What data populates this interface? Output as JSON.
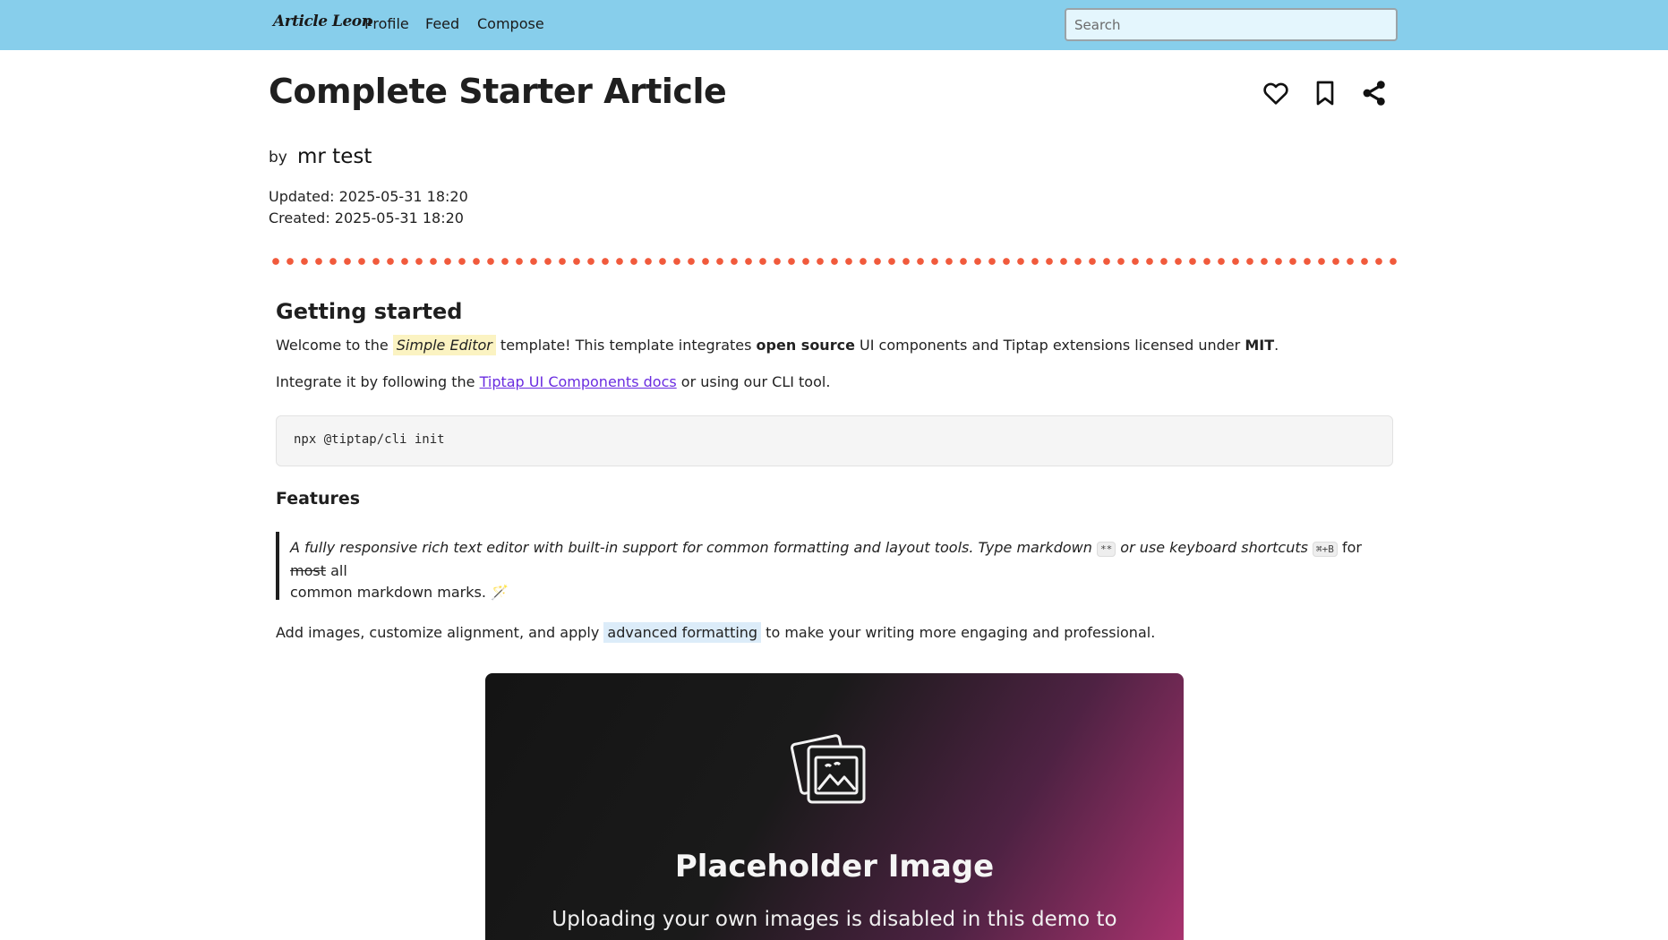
{
  "nav": {
    "brand": "Article Leon",
    "links": [
      "Profile",
      "Feed",
      "Compose"
    ],
    "search_placeholder": "Search"
  },
  "article": {
    "title": "Complete Starter Article",
    "by_label": "by",
    "author": "mr test",
    "updated": "Updated: 2025-05-31 18:20",
    "created": "Created: 2025-05-31 18:20",
    "actions": {
      "like_icon": "heart-icon",
      "bookmark_icon": "bookmark-icon",
      "share_icon": "share-icon"
    }
  },
  "content": {
    "h_getting_started": "Getting started",
    "p1": {
      "a": "Welcome to the ",
      "highlight": "Simple Editor",
      "b": " template! This template integrates ",
      "bold1": "open source",
      "c": " UI components and Tiptap extensions licensed under ",
      "bold2": "MIT",
      "d": "."
    },
    "p2": {
      "a": "Integrate it by following the ",
      "link": "Tiptap UI Components docs",
      "b": " or using our CLI tool."
    },
    "code": "npx @tiptap/cli init",
    "h_features": "Features",
    "quote": {
      "a": "A fully responsive rich text editor with built-in support for common formatting and layout tools. Type markdown ",
      "kbd1": "**",
      "b": " or use keyboard shortcuts ",
      "kbd2": "⌘+B",
      "c": " for ",
      "strike": "most",
      "d": " all",
      "e": "common markdown marks. ",
      "emoji": "🪄"
    },
    "p3": {
      "a": "Add images, customize alignment, and apply ",
      "highlight": "advanced formatting",
      "b": " to make your writing more engaging and professional."
    },
    "image": {
      "icon": "image-placeholder-icon",
      "title": "Placeholder Image",
      "subtitle": "Uploading your own images is disabled in this demo to"
    }
  },
  "colors": {
    "nav_bg": "#87ceeb",
    "divider_dots": "#f15a3c",
    "link": "#6a2ce0"
  }
}
